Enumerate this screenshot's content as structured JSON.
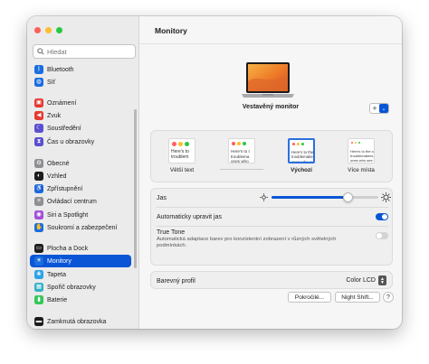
{
  "sidebar": {
    "search_placeholder": "Hledat",
    "items": [
      {
        "label": "Bluetooth",
        "icon": "bluetooth-icon",
        "color": "#1a6de0",
        "glyph": "ᛒ"
      },
      {
        "label": "Síť",
        "icon": "network-icon",
        "color": "#1a6de0",
        "glyph": "◍"
      },
      {
        "label": "Oznámení",
        "icon": "notifications-icon",
        "color": "#e5392f",
        "glyph": "▣"
      },
      {
        "label": "Zvuk",
        "icon": "sound-icon",
        "color": "#e5392f",
        "glyph": "◀"
      },
      {
        "label": "Soustředění",
        "icon": "focus-icon",
        "color": "#5b4fd0",
        "glyph": "☾"
      },
      {
        "label": "Čas u obrazovky",
        "icon": "screen-time-icon",
        "color": "#5b4fd0",
        "glyph": "⧗"
      },
      {
        "label": "Obecné",
        "icon": "general-icon",
        "color": "#8e8e93",
        "glyph": "⚙"
      },
      {
        "label": "Vzhled",
        "icon": "appearance-icon",
        "color": "#1d1d1f",
        "glyph": "◐"
      },
      {
        "label": "Zpřístupnění",
        "icon": "accessibility-icon",
        "color": "#1a6de0",
        "glyph": "♿"
      },
      {
        "label": "Ovládací centrum",
        "icon": "control-center-icon",
        "color": "#8e8e93",
        "glyph": "≡"
      },
      {
        "label": "Siri a Spotlight",
        "icon": "siri-icon",
        "color": "#a44dd6",
        "glyph": "◉"
      },
      {
        "label": "Soukromí a zabezpečení",
        "icon": "privacy-hand-icon",
        "color": "#1a6de0",
        "glyph": "✋"
      },
      {
        "label": "Plocha a Dock",
        "icon": "desktop-dock-icon",
        "color": "#1d1d1f",
        "glyph": "▭"
      },
      {
        "label": "Monitory",
        "icon": "displays-sun-icon",
        "color": "#1a6de0",
        "glyph": "☀"
      },
      {
        "label": "Tapeta",
        "icon": "wallpaper-icon",
        "color": "#2aa3e8",
        "glyph": "❀"
      },
      {
        "label": "Spořič obrazovky",
        "icon": "screensaver-icon",
        "color": "#30b0c7",
        "glyph": "▦"
      },
      {
        "label": "Baterie",
        "icon": "battery-icon",
        "color": "#34c759",
        "glyph": "▮"
      },
      {
        "label": "Zamknutá obrazovka",
        "icon": "lock-screen-icon",
        "color": "#1d1d1f",
        "glyph": "▬"
      }
    ],
    "active_index": 13
  },
  "main": {
    "title": "Monitory",
    "monitor_name": "Vestavěný monitor",
    "resolutions": [
      {
        "label": "Větší text",
        "sample": "Here's to\ntroublem",
        "selected": false
      },
      {
        "label": "",
        "sample": "Here's to t\ntroublema\nones who",
        "selected": false
      },
      {
        "label": "Výchozí",
        "sample": "Here's to the cr\ntroublemakers.\nones who see the",
        "selected": true
      },
      {
        "label": "Více místa",
        "sample": "Here's to the crazy o\ntroublemakers. The ro\nones who see things d",
        "selected": false
      }
    ],
    "brightness_label": "Jas",
    "brightness": 0.72,
    "auto_brightness_label": "Automaticky upravit jas",
    "auto_brightness_on": true,
    "true_tone_label": "True Tone",
    "true_tone_desc": "Automatická adaptace barev pro konzistentní zobrazení v různých světelných podmínkách.",
    "true_tone_on": false,
    "color_profile_label": "Barevný profil",
    "color_profile_value": "Color LCD",
    "advanced_button": "Pokročilé...",
    "night_shift_button": "Night Shift...",
    "help_button": "?",
    "accent_color": "#0a55d6"
  }
}
